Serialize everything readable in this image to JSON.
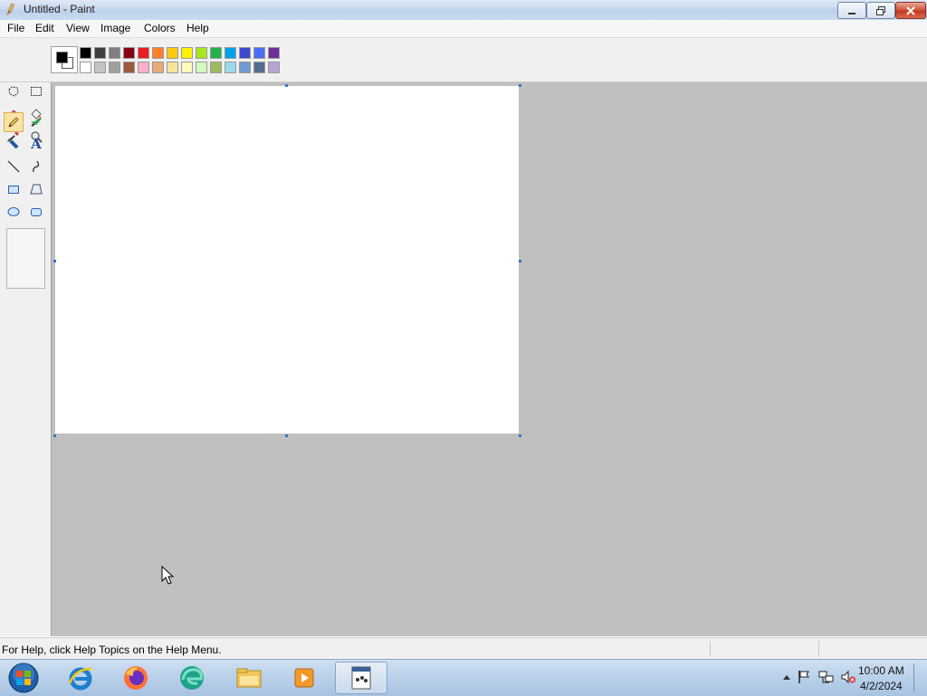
{
  "window": {
    "title": "Untitled - Paint"
  },
  "menu": [
    "File",
    "Edit",
    "View",
    "Image",
    "Colors",
    "Help"
  ],
  "colors": {
    "foreground": "#000000",
    "background": "#ffffff",
    "palette_top": [
      "#000000",
      "#3f3f3f",
      "#7f7f7f",
      "#880015",
      "#ed1c24",
      "#ff7f27",
      "#ffc90e",
      "#fff200",
      "#a8e61d",
      "#22b14c",
      "#00a2e8",
      "#3f48cc",
      "#4d6df3",
      "#6f3198"
    ],
    "palette_bottom": [
      "#ffffff",
      "#c3c3c3",
      "#a0a0a0",
      "#9c5a3c",
      "#ffaec9",
      "#e5aa7a",
      "#f5e49c",
      "#fff9bd",
      "#d3f9bc",
      "#9dbb61",
      "#99d9ea",
      "#709ad1",
      "#546d8e",
      "#b5a5d5"
    ]
  },
  "tools": [
    {
      "name": "free-select-icon",
      "selected": false
    },
    {
      "name": "rect-select-icon",
      "selected": false
    },
    {
      "name": "eraser-icon",
      "selected": false
    },
    {
      "name": "fill-icon",
      "selected": false
    },
    {
      "name": "color-picker-icon",
      "selected": false
    },
    {
      "name": "magnifier-icon",
      "selected": false
    },
    {
      "name": "pencil-icon",
      "selected": true
    },
    {
      "name": "brush-icon",
      "selected": false
    },
    {
      "name": "airbrush-icon",
      "selected": false
    },
    {
      "name": "text-icon",
      "selected": false
    },
    {
      "name": "line-icon",
      "selected": false
    },
    {
      "name": "curve-icon",
      "selected": false
    },
    {
      "name": "rectangle-icon",
      "selected": false
    },
    {
      "name": "polygon-icon",
      "selected": false
    },
    {
      "name": "ellipse-icon",
      "selected": false
    },
    {
      "name": "rounded-rectangle-icon",
      "selected": false
    }
  ],
  "text_tool_glyph": "A",
  "status": {
    "help_text": "For Help, click Help Topics on the Help Menu."
  },
  "taskbar": {
    "items": [
      "start-orb-icon",
      "internet-explorer-icon",
      "firefox-icon",
      "edge-icon",
      "file-explorer-icon",
      "media-player-icon",
      "paint-task-icon"
    ],
    "clock_time": "10:00 AM",
    "clock_date": "4/2/2024"
  }
}
